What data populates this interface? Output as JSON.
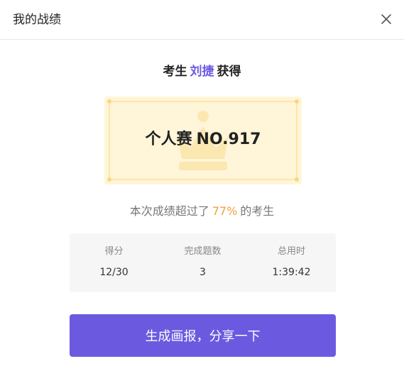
{
  "modal": {
    "title": "我的战绩",
    "close_icon": "close-icon"
  },
  "headline": {
    "prefix": "考生",
    "name": "刘捷",
    "suffix": "获得"
  },
  "rank_card": {
    "label": "个人赛",
    "rank": "NO.917",
    "background_icon": "crown-icon"
  },
  "percent_line": {
    "prefix": "本次成绩超过了",
    "percent": "77%",
    "suffix": "的考生"
  },
  "stats": [
    {
      "label": "得分",
      "value": "12/30"
    },
    {
      "label": "完成题数",
      "value": "3"
    },
    {
      "label": "总用时",
      "value": "1:39:42"
    }
  ],
  "share_button": {
    "label": "生成画报，分享一下"
  },
  "colors": {
    "accent": "#6b5ae0",
    "percent": "#f0a03c",
    "card_bg": "#fff5d9",
    "card_border": "#ffe7a3",
    "stats_bg": "#f6f6f6"
  }
}
